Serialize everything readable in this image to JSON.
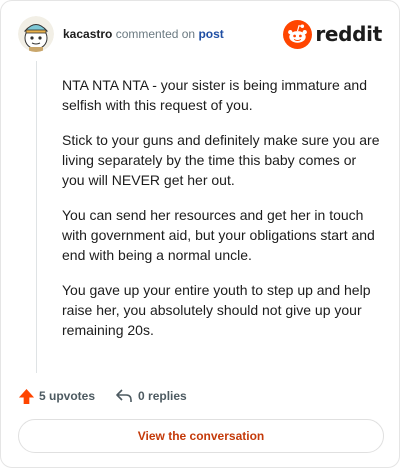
{
  "header": {
    "username": "kacastro",
    "action_text": "commented on",
    "post_link": "post",
    "brand_wordmark": "reddit"
  },
  "comment": {
    "paragraphs": [
      "NTA NTA NTA - your sister is being immature and selfish with this request of you.",
      "Stick to your guns and definitely make sure you are living separately by the time this baby comes or you will NEVER get her out.",
      "You can send her resources and get her in touch with government aid, but your obligations start and end with being a normal uncle.",
      "You gave up your entire youth to step up and help raise her, you absolutely should not give up your remaining 20s."
    ]
  },
  "stats": {
    "upvotes": "5 upvotes",
    "replies": "0 replies"
  },
  "cta": {
    "label": "View the conversation"
  },
  "colors": {
    "brand_orange": "#ff4500",
    "link_blue": "#1f4ea3",
    "cta_text": "#c43a0a",
    "upvote_arrow": "#ff4500"
  },
  "icons": {
    "avatar": "snoo-avatar-icon",
    "brand": "reddit-logo-icon",
    "upvote": "upvote-arrow-icon",
    "reply": "reply-arrow-icon"
  }
}
